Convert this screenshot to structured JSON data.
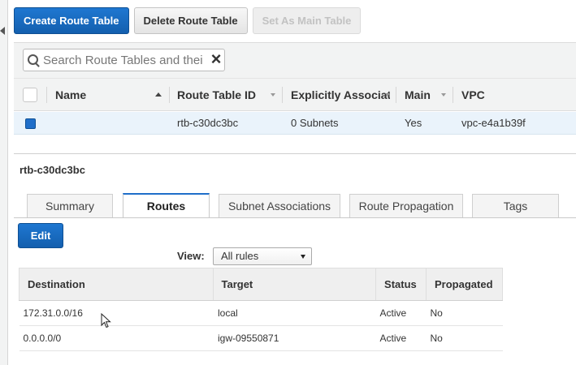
{
  "toolbar": {
    "create_label": "Create Route Table",
    "delete_label": "Delete Route Table",
    "set_main_label": "Set As Main Table"
  },
  "search": {
    "placeholder": "Search Route Tables and thei"
  },
  "grid": {
    "columns": [
      "Name",
      "Route Table ID",
      "Explicitly Associat",
      "Main",
      "VPC"
    ],
    "rows": [
      {
        "selected": true,
        "name": "",
        "route_table_id": "rtb-c30dc3bc",
        "explicitly_associated": "0 Subnets",
        "main": "Yes",
        "vpc": "vpc-e4a1b39f"
      }
    ]
  },
  "details": {
    "title": "rtb-c30dc3bc",
    "tabs": [
      {
        "label": "Summary",
        "active": false
      },
      {
        "label": "Routes",
        "active": true
      },
      {
        "label": "Subnet Associations",
        "active": false
      },
      {
        "label": "Route Propagation",
        "active": false
      },
      {
        "label": "Tags",
        "active": false
      }
    ],
    "edit_label": "Edit",
    "view_label": "View:",
    "view_value": "All rules",
    "routes_columns": [
      "Destination",
      "Target",
      "Status",
      "Propagated"
    ],
    "routes": [
      {
        "destination": "172.31.0.0/16",
        "target": "local",
        "target_is_link": false,
        "status": "Active",
        "propagated": "No"
      },
      {
        "destination": "0.0.0.0/0",
        "target": "igw-09550871",
        "target_is_link": true,
        "status": "Active",
        "propagated": "No"
      }
    ]
  },
  "colors": {
    "primary": "#1f6ec9",
    "link": "#2a6db5",
    "status_active": "#2e9b2e",
    "selected_row": "#eaf3fb"
  }
}
